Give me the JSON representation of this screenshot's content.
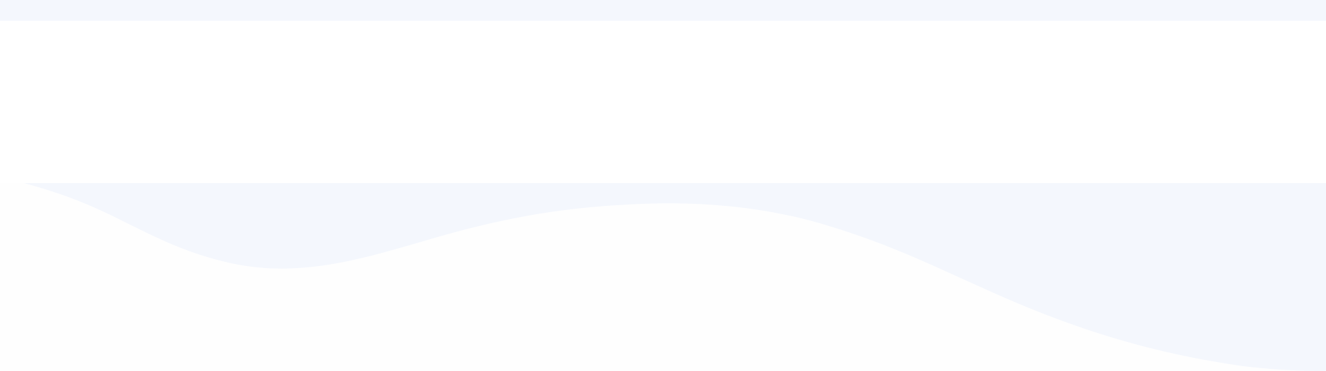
{
  "colors": {
    "page_background": "#ffffff",
    "top_band": "#f4f7fd",
    "wave_fill": "#f4f7fd",
    "foreground_wave_fill": "#fefefe"
  }
}
